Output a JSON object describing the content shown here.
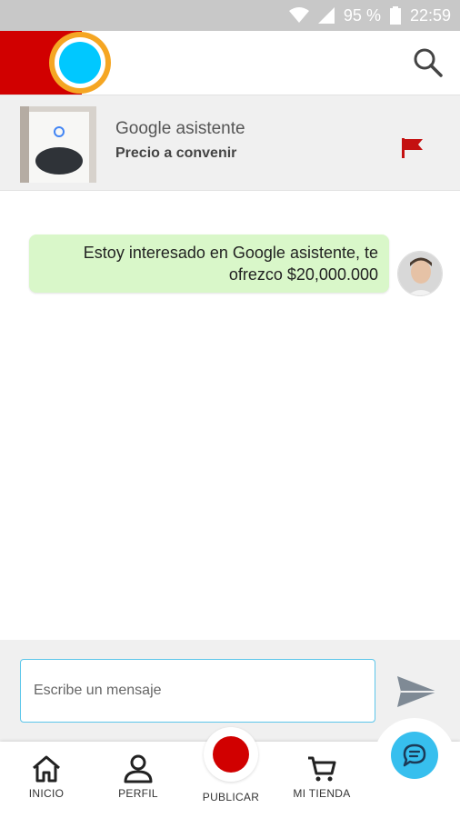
{
  "status_bar": {
    "battery": "95 %",
    "time": "22:59"
  },
  "product": {
    "title": "Google asistente",
    "price": "Precio a convenir"
  },
  "chat": {
    "messages": [
      {
        "text": "Estoy interesado en Google asistente, te ofrezco $20,000.000"
      }
    ]
  },
  "composer": {
    "placeholder": "Escribe un mensaje"
  },
  "nav": {
    "home": "INICIO",
    "profile": "PERFIL",
    "publish": "PUBLICAR",
    "store": "MI TIENDA"
  },
  "icons": {
    "search": "search-icon",
    "flag": "flag-icon",
    "send": "send-icon",
    "home": "home-icon",
    "profile": "person-icon",
    "store": "cart-icon",
    "chat": "chat-bubble-icon"
  },
  "colors": {
    "brand_red": "#d10000",
    "accent_blue": "#29c5f6",
    "accent_orange": "#f5a623",
    "bubble_green": "#d9f7c9",
    "status_gray": "#c8c8c8"
  }
}
